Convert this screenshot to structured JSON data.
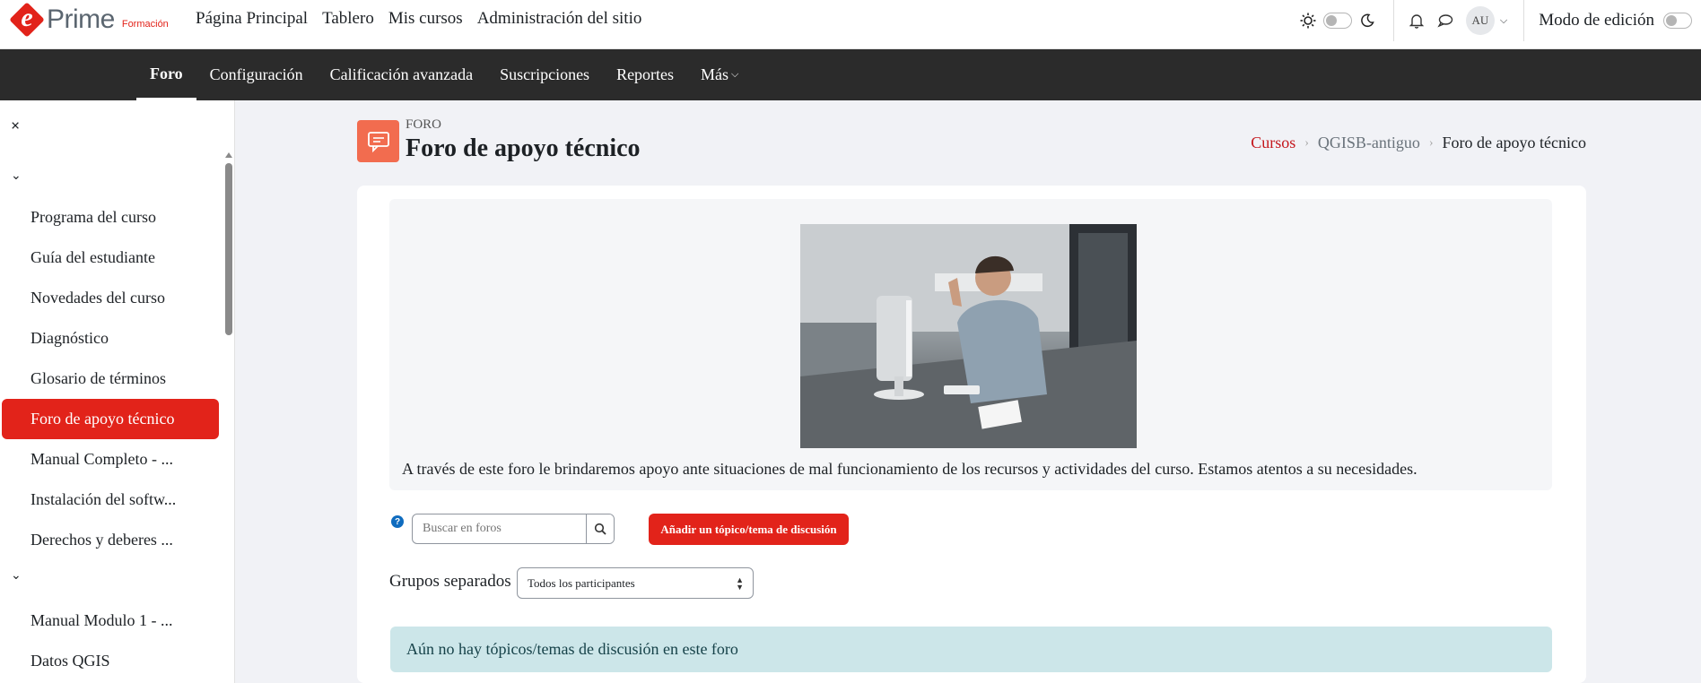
{
  "brand": {
    "e": "e",
    "name": "Prime",
    "sub": "Formación",
    "accent": "#e2231a"
  },
  "topnav": [
    "Página Principal",
    "Tablero",
    "Mis cursos",
    "Administración del sitio"
  ],
  "user": {
    "initials": "AU"
  },
  "edit_mode_label": "Modo de edición",
  "secnav": {
    "items": [
      "Foro",
      "Configuración",
      "Calificación avanzada",
      "Suscripciones",
      "Reportes",
      "Más"
    ],
    "active": "Foro"
  },
  "drawer": {
    "close": "×",
    "section1_items": [
      "Programa del curso",
      "Guía del estudiante",
      "Novedades del curso",
      "Diagnóstico",
      "Glosario de términos",
      "Foro de apoyo técnico",
      "Manual Completo - ...",
      "Instalación del softw...",
      "Derechos y deberes ..."
    ],
    "active_index": 5,
    "section2_items": [
      "Manual Modulo 1 - ...",
      "Datos QGIS"
    ]
  },
  "header": {
    "activity_type": "FORO",
    "title": "Foro de apoyo técnico"
  },
  "breadcrumb": [
    "Cursos",
    "QGISB-antiguo",
    "Foro de apoyo técnico"
  ],
  "intro": {
    "text": "A través de este foro le brindaremos apoyo ante situaciones de mal funcionamiento de los recursos y actividades del curso. Estamos atentos a su necesidades."
  },
  "search": {
    "placeholder": "Buscar en foros"
  },
  "add_button": "Añadir un tópico/tema de discusión",
  "groups": {
    "label": "Grupos separados",
    "selected": "Todos los participantes"
  },
  "alert": "Aún no hay tópicos/temas de discusión en este foro"
}
